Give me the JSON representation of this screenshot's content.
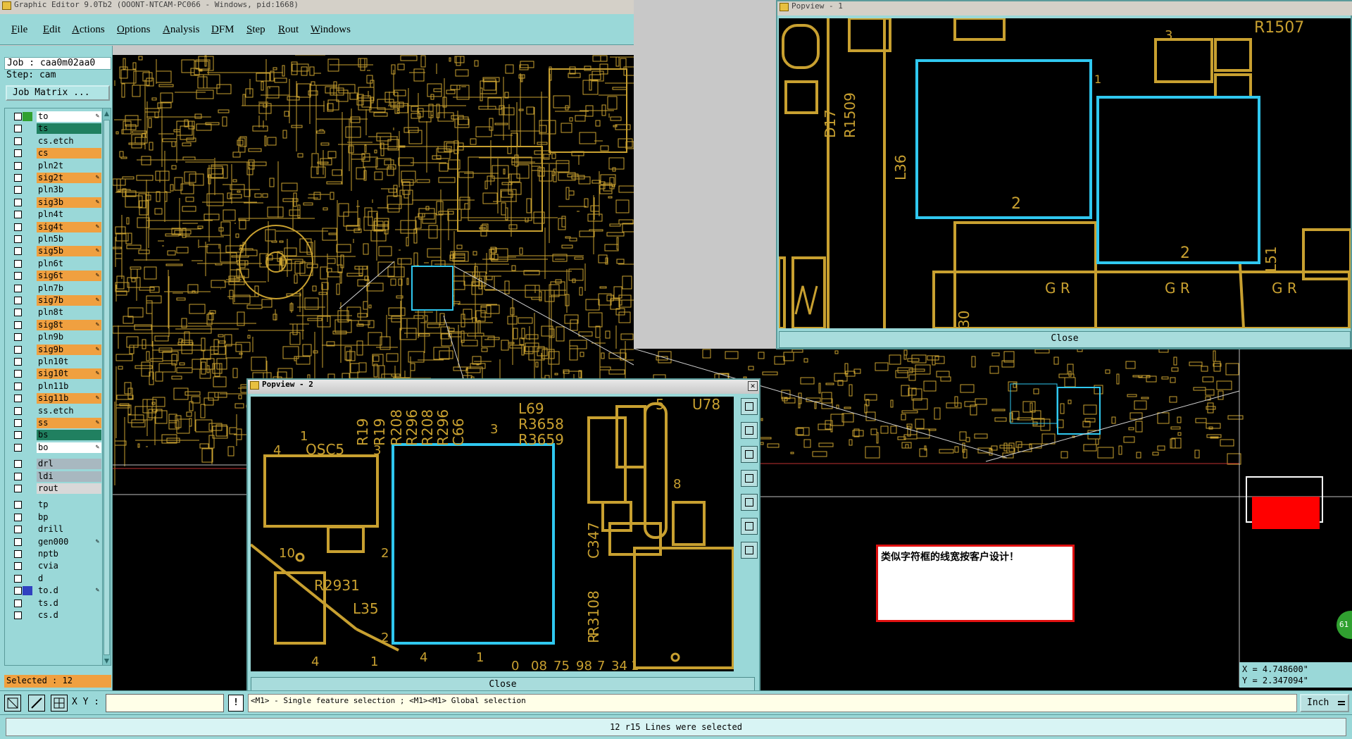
{
  "main_window": {
    "title": "Graphic Editor 9.0Tb2 (OOONT-NTCAM-PC066 - Windows, pid:1668)"
  },
  "menu": [
    "File",
    "Edit",
    "Actions",
    "Options",
    "Analysis",
    "DFM",
    "Step",
    "Rout",
    "Windows"
  ],
  "job": {
    "label": "Job : caa0m02aa0",
    "step": "Step: cam",
    "matrix_button": "Job Matrix ..."
  },
  "layers": [
    {
      "name": "to",
      "color": "#ffffff",
      "cb_color": "#30a030",
      "edit": true
    },
    {
      "name": "ts",
      "color": "#208060",
      "cb_color": "",
      "edit": false
    },
    {
      "name": "cs.etch",
      "color": "#9ad8d8",
      "cb_color": "",
      "edit": false
    },
    {
      "name": "cs",
      "color": "#f0a040",
      "cb_color": "",
      "edit": false
    },
    {
      "name": "pln2t",
      "color": "#9ad8d8",
      "cb_color": "",
      "edit": false
    },
    {
      "name": "sig2t",
      "color": "#f0a040",
      "cb_color": "",
      "edit": true
    },
    {
      "name": "pln3b",
      "color": "#9ad8d8",
      "cb_color": "",
      "edit": false
    },
    {
      "name": "sig3b",
      "color": "#f0a040",
      "cb_color": "",
      "edit": true
    },
    {
      "name": "pln4t",
      "color": "#9ad8d8",
      "cb_color": "",
      "edit": false
    },
    {
      "name": "sig4t",
      "color": "#f0a040",
      "cb_color": "",
      "edit": true
    },
    {
      "name": "pln5b",
      "color": "#9ad8d8",
      "cb_color": "",
      "edit": false
    },
    {
      "name": "sig5b",
      "color": "#f0a040",
      "cb_color": "",
      "edit": true
    },
    {
      "name": "pln6t",
      "color": "#9ad8d8",
      "cb_color": "",
      "edit": false
    },
    {
      "name": "sig6t",
      "color": "#f0a040",
      "cb_color": "",
      "edit": true
    },
    {
      "name": "pln7b",
      "color": "#9ad8d8",
      "cb_color": "",
      "edit": false
    },
    {
      "name": "sig7b",
      "color": "#f0a040",
      "cb_color": "",
      "edit": true
    },
    {
      "name": "pln8t",
      "color": "#9ad8d8",
      "cb_color": "",
      "edit": false
    },
    {
      "name": "sig8t",
      "color": "#f0a040",
      "cb_color": "",
      "edit": true
    },
    {
      "name": "pln9b",
      "color": "#9ad8d8",
      "cb_color": "",
      "edit": false
    },
    {
      "name": "sig9b",
      "color": "#f0a040",
      "cb_color": "",
      "edit": true
    },
    {
      "name": "pln10t",
      "color": "#9ad8d8",
      "cb_color": "",
      "edit": false
    },
    {
      "name": "sig10t",
      "color": "#f0a040",
      "cb_color": "",
      "edit": true
    },
    {
      "name": "pln11b",
      "color": "#9ad8d8",
      "cb_color": "",
      "edit": false
    },
    {
      "name": "sig11b",
      "color": "#f0a040",
      "cb_color": "",
      "edit": true
    },
    {
      "name": "ss.etch",
      "color": "#9ad8d8",
      "cb_color": "",
      "edit": false
    },
    {
      "name": "ss",
      "color": "#f0a040",
      "cb_color": "",
      "edit": true
    },
    {
      "name": "bs",
      "color": "#208060",
      "cb_color": "",
      "edit": false
    },
    {
      "name": "bo",
      "color": "#ffffff",
      "cb_color": "",
      "edit": true
    },
    {
      "name": "drl",
      "color": "#a8b8c0",
      "cb_color": "",
      "edit": false
    },
    {
      "name": "ldi",
      "color": "#a8b8c0",
      "cb_color": "",
      "edit": false
    },
    {
      "name": "rout",
      "color": "#d8d8d8",
      "cb_color": "",
      "edit": false
    },
    {
      "name": "tp",
      "color": "#9ad8d8",
      "cb_color": "",
      "edit": false
    },
    {
      "name": "bp",
      "color": "#9ad8d8",
      "cb_color": "",
      "edit": false
    },
    {
      "name": "drill",
      "color": "#9ad8d8",
      "cb_color": "",
      "edit": false
    },
    {
      "name": "gen000",
      "color": "#9ad8d8",
      "cb_color": "",
      "edit": true
    },
    {
      "name": "nptb",
      "color": "#9ad8d8",
      "cb_color": "",
      "edit": false
    },
    {
      "name": "cvia",
      "color": "#9ad8d8",
      "cb_color": "",
      "edit": false
    },
    {
      "name": "d",
      "color": "#9ad8d8",
      "cb_color": "",
      "edit": false
    },
    {
      "name": "to.d",
      "color": "#9ad8d8",
      "cb_color": "#3040c0",
      "edit": true
    },
    {
      "name": "ts.d",
      "color": "#9ad8d8",
      "cb_color": "",
      "edit": false
    },
    {
      "name": "cs.d",
      "color": "#9ad8d8",
      "cb_color": "",
      "edit": false
    }
  ],
  "selected_count": "Selected : 12",
  "xy_label": "X Y :",
  "xy_input": "",
  "hint_text": "<M1> - Single feature selection ; <M1><M1> Global selection",
  "status_text": "12 r15 Lines were selected",
  "units": "Inch",
  "coords": {
    "x": "X = 4.748600\"",
    "y": "Y = 2.347094\""
  },
  "note_text": "类似字符框的线宽按客户设计！",
  "popview1": {
    "title": "Popview - 1",
    "close": "Close",
    "labels": [
      "R1507",
      "R1509",
      "D17",
      "L36",
      "L51",
      "2",
      "2",
      "G R",
      "G R",
      "G R",
      "30",
      "3",
      "1"
    ]
  },
  "popview2": {
    "title": "Popview - 2",
    "close": "Close",
    "labels": [
      "R19",
      "R19",
      "R208",
      "R296",
      "R208",
      "R296",
      "C66",
      "L69",
      "R3658",
      "R3659",
      "5",
      "U78",
      "1",
      "4",
      "OSC5",
      "3",
      "3",
      "8",
      "10",
      "2",
      "R2931",
      "L35",
      "2",
      "R3108",
      "C347",
      "R",
      "4",
      "1",
      "4",
      "1",
      "08",
      "0",
      "75",
      "98",
      "7",
      "34",
      "1"
    ]
  },
  "badge": "61",
  "colors": {
    "cyan_panel": "#9ad8d8",
    "pcb_gold": "#c8a030",
    "highlight": "#30c8f0",
    "note_border": "#e01010",
    "red_patch": "#ff0000"
  }
}
